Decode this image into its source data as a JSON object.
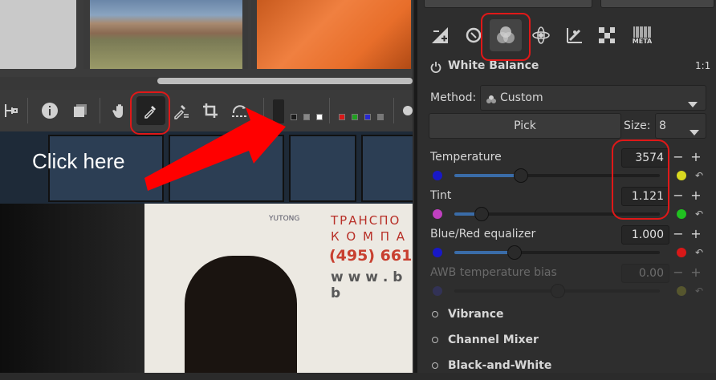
{
  "left_panel": {
    "photo_text": {
      "brand": "YUTONG",
      "line1": "ТРАНСПО",
      "line2": "К О М П А",
      "phone": "(495) 661",
      "web": "w w w . b b"
    }
  },
  "annotation": {
    "text": "Click here",
    "colors": {
      "arrow": "#ff0000",
      "ring": "#e01818"
    }
  },
  "right_panel": {
    "tabs": [
      {
        "icon": "exposure-icon"
      },
      {
        "icon": "details-icon"
      },
      {
        "icon": "color-icon"
      },
      {
        "icon": "advanced-icon"
      },
      {
        "icon": "transform-icon"
      },
      {
        "icon": "raw-icon"
      },
      {
        "icon": "meta-icon",
        "label": "META"
      }
    ],
    "white_balance": {
      "title": "White Balance",
      "ratio": "1:1",
      "method_label": "Method:",
      "method_value": "Custom",
      "pick_label": "Pick",
      "size_label": "Size:",
      "size_value": "8",
      "temperature": {
        "label": "Temperature",
        "value": "3574",
        "slider_fraction": 0.32,
        "left_color": "#1818c8",
        "right_color": "#d8d820"
      },
      "tint": {
        "label": "Tint",
        "value": "1.121",
        "slider_fraction": 0.13,
        "left_color": "#c040c0",
        "right_color": "#20c020"
      },
      "blue_red": {
        "label": "Blue/Red equalizer",
        "value": "1.000",
        "slider_fraction": 0.29,
        "left_color": "#1818c8",
        "right_color": "#d81818"
      },
      "awb_bias": {
        "label": "AWB temperature bias",
        "value": "0.00",
        "slider_fraction": 0.5
      }
    },
    "sections": [
      "Vibrance",
      "Channel Mixer",
      "Black-and-White"
    ]
  }
}
